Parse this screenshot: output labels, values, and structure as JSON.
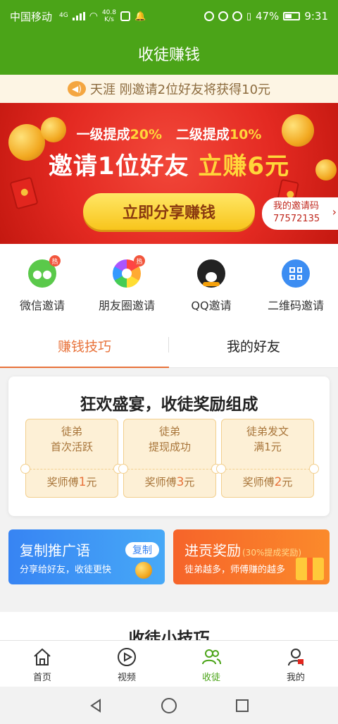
{
  "status_bar": {
    "carrier": "中国移动",
    "net_type": "4G",
    "speed_value": "40.8",
    "speed_unit": "K/s",
    "battery": "47%",
    "time": "9:31"
  },
  "header": {
    "title": "收徒赚钱"
  },
  "notice": {
    "text": "天涯  刚邀请2位好友将获得10元"
  },
  "banner": {
    "level1_label": "一级提成",
    "level1_value": "20%",
    "level2_label": "二级提成",
    "level2_value": "10%",
    "headline": "邀请1位好友",
    "headline_reward": "立赚6元",
    "share_button": "立即分享赚钱",
    "invite_code_label": "我的邀请码",
    "invite_code": "77572135"
  },
  "invite_methods": [
    {
      "label": "微信邀请",
      "icon": "wechat-icon",
      "hot": "热"
    },
    {
      "label": "朋友圈邀请",
      "icon": "moments-icon",
      "hot": "热"
    },
    {
      "label": "QQ邀请",
      "icon": "qq-icon"
    },
    {
      "label": "二维码邀请",
      "icon": "qrcode-icon"
    }
  ],
  "tabs": [
    {
      "label": "赚钱技巧",
      "active": true
    },
    {
      "label": "我的好友",
      "active": false
    }
  ],
  "reward": {
    "title": "狂欢盛宴，收徒奖励组成",
    "tickets": [
      {
        "line1": "徒弟",
        "line2": "首次活跃",
        "reward_prefix": "奖师傅",
        "amount": "1",
        "unit": "元"
      },
      {
        "line1": "徒弟",
        "line2": "提现成功",
        "reward_prefix": "奖师傅",
        "amount": "3",
        "unit": "元"
      },
      {
        "line1": "徒弟发文",
        "line2": "满1元",
        "reward_prefix": "奖师傅",
        "amount": "2",
        "unit": "元"
      }
    ]
  },
  "promos": {
    "copy": {
      "title": "复制推广语",
      "subtitle": "分享给好友，收徒更快",
      "button": "复制"
    },
    "tribute": {
      "title": "进贡奖励",
      "tag": "(30%提成奖励)",
      "subtitle": "徒弟越多，师傅赚的越多"
    }
  },
  "tips": {
    "title": "收徒小技巧"
  },
  "bottom_nav": [
    {
      "label": "首页",
      "icon": "home-icon",
      "active": false
    },
    {
      "label": "视频",
      "icon": "video-icon",
      "active": false
    },
    {
      "label": "收徒",
      "icon": "disciples-icon",
      "active": true
    },
    {
      "label": "我的",
      "icon": "profile-icon",
      "active": false
    }
  ],
  "colors": {
    "brand_green": "#4ba418",
    "accent_orange": "#e8723a",
    "banner_red": "#e42a22",
    "gold": "#ffd63a"
  }
}
